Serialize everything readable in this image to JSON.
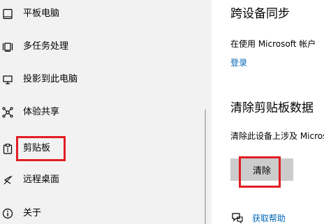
{
  "nav": {
    "items": [
      {
        "label": "平板电脑",
        "icon": "tablet-icon"
      },
      {
        "label": "多任务处理",
        "icon": "multitasking-icon"
      },
      {
        "label": "投影到此电脑",
        "icon": "project-to-pc-icon"
      },
      {
        "label": "体验共享",
        "icon": "shared-experiences-icon"
      },
      {
        "label": "剪贴板",
        "icon": "clipboard-icon"
      },
      {
        "label": "远程桌面",
        "icon": "remote-desktop-icon"
      },
      {
        "label": "关于",
        "icon": "info-icon"
      }
    ],
    "selected": "剪贴板"
  },
  "content": {
    "sync": {
      "title": "跨设备同步",
      "description": "在使用 Microsoft 帐户",
      "signin_link": "登录"
    },
    "clear": {
      "title": "清除剪贴板数据",
      "description": "清除此设备上涉及 Microsoft",
      "button_label": "清除"
    },
    "help": {
      "link": "获取帮助",
      "icon": "help-chat-icon"
    }
  },
  "colors": {
    "nav_background": "#f2f2f2",
    "content_background": "#ffffff",
    "accent_link": "#0067b8",
    "button_background": "#cccccc",
    "highlight_border": "#e21d24"
  }
}
